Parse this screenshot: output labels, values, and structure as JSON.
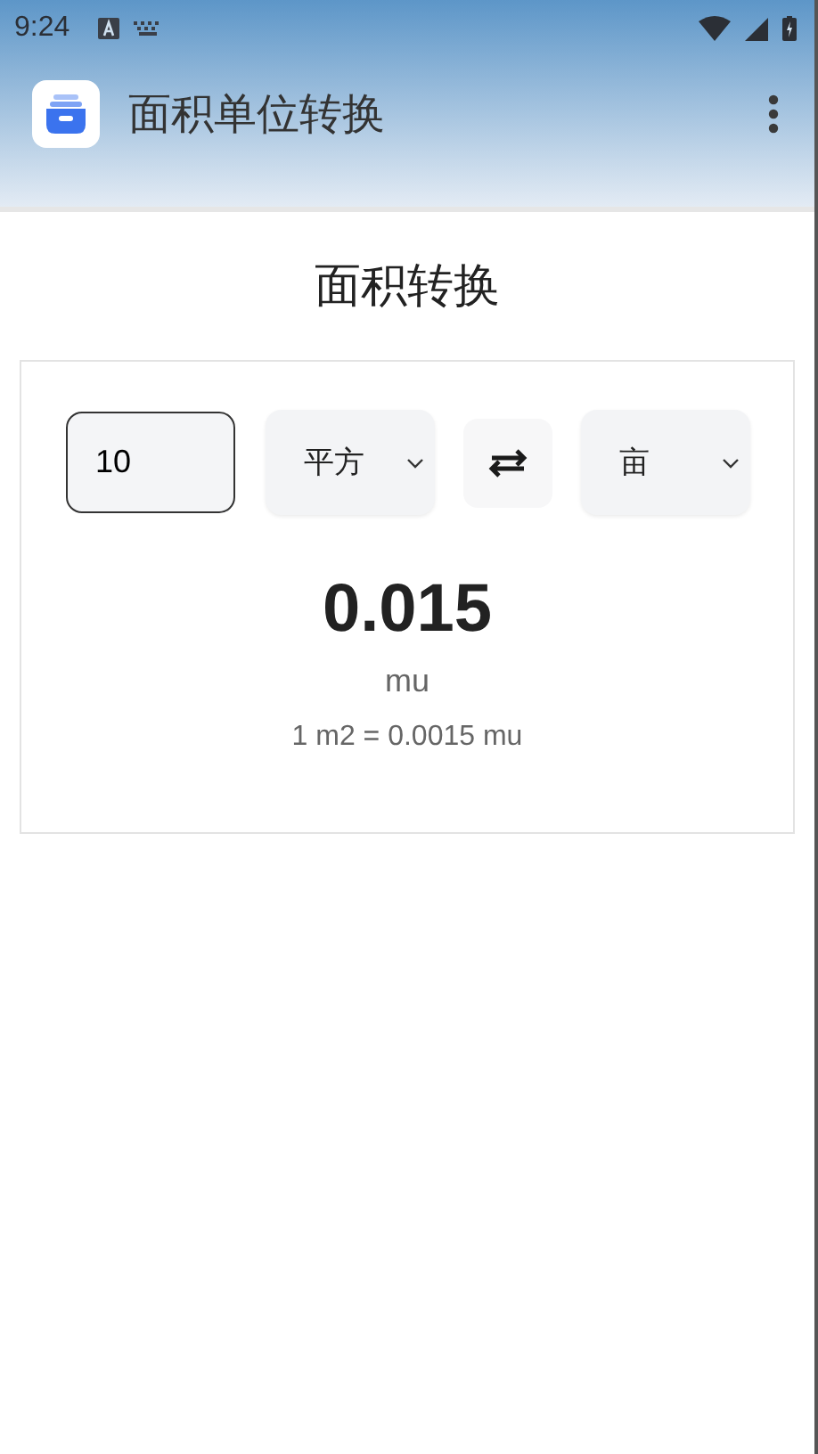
{
  "status_bar": {
    "time": "9:24"
  },
  "app_bar": {
    "title": "面积单位转换"
  },
  "page": {
    "heading": "面积转换"
  },
  "converter": {
    "input": {
      "value": "10"
    },
    "from_unit": {
      "value": "平方"
    },
    "to_unit": {
      "value": "亩"
    },
    "result": "0.015",
    "result_unit": "mu",
    "rate": "1 m2 = 0.0015 mu"
  }
}
